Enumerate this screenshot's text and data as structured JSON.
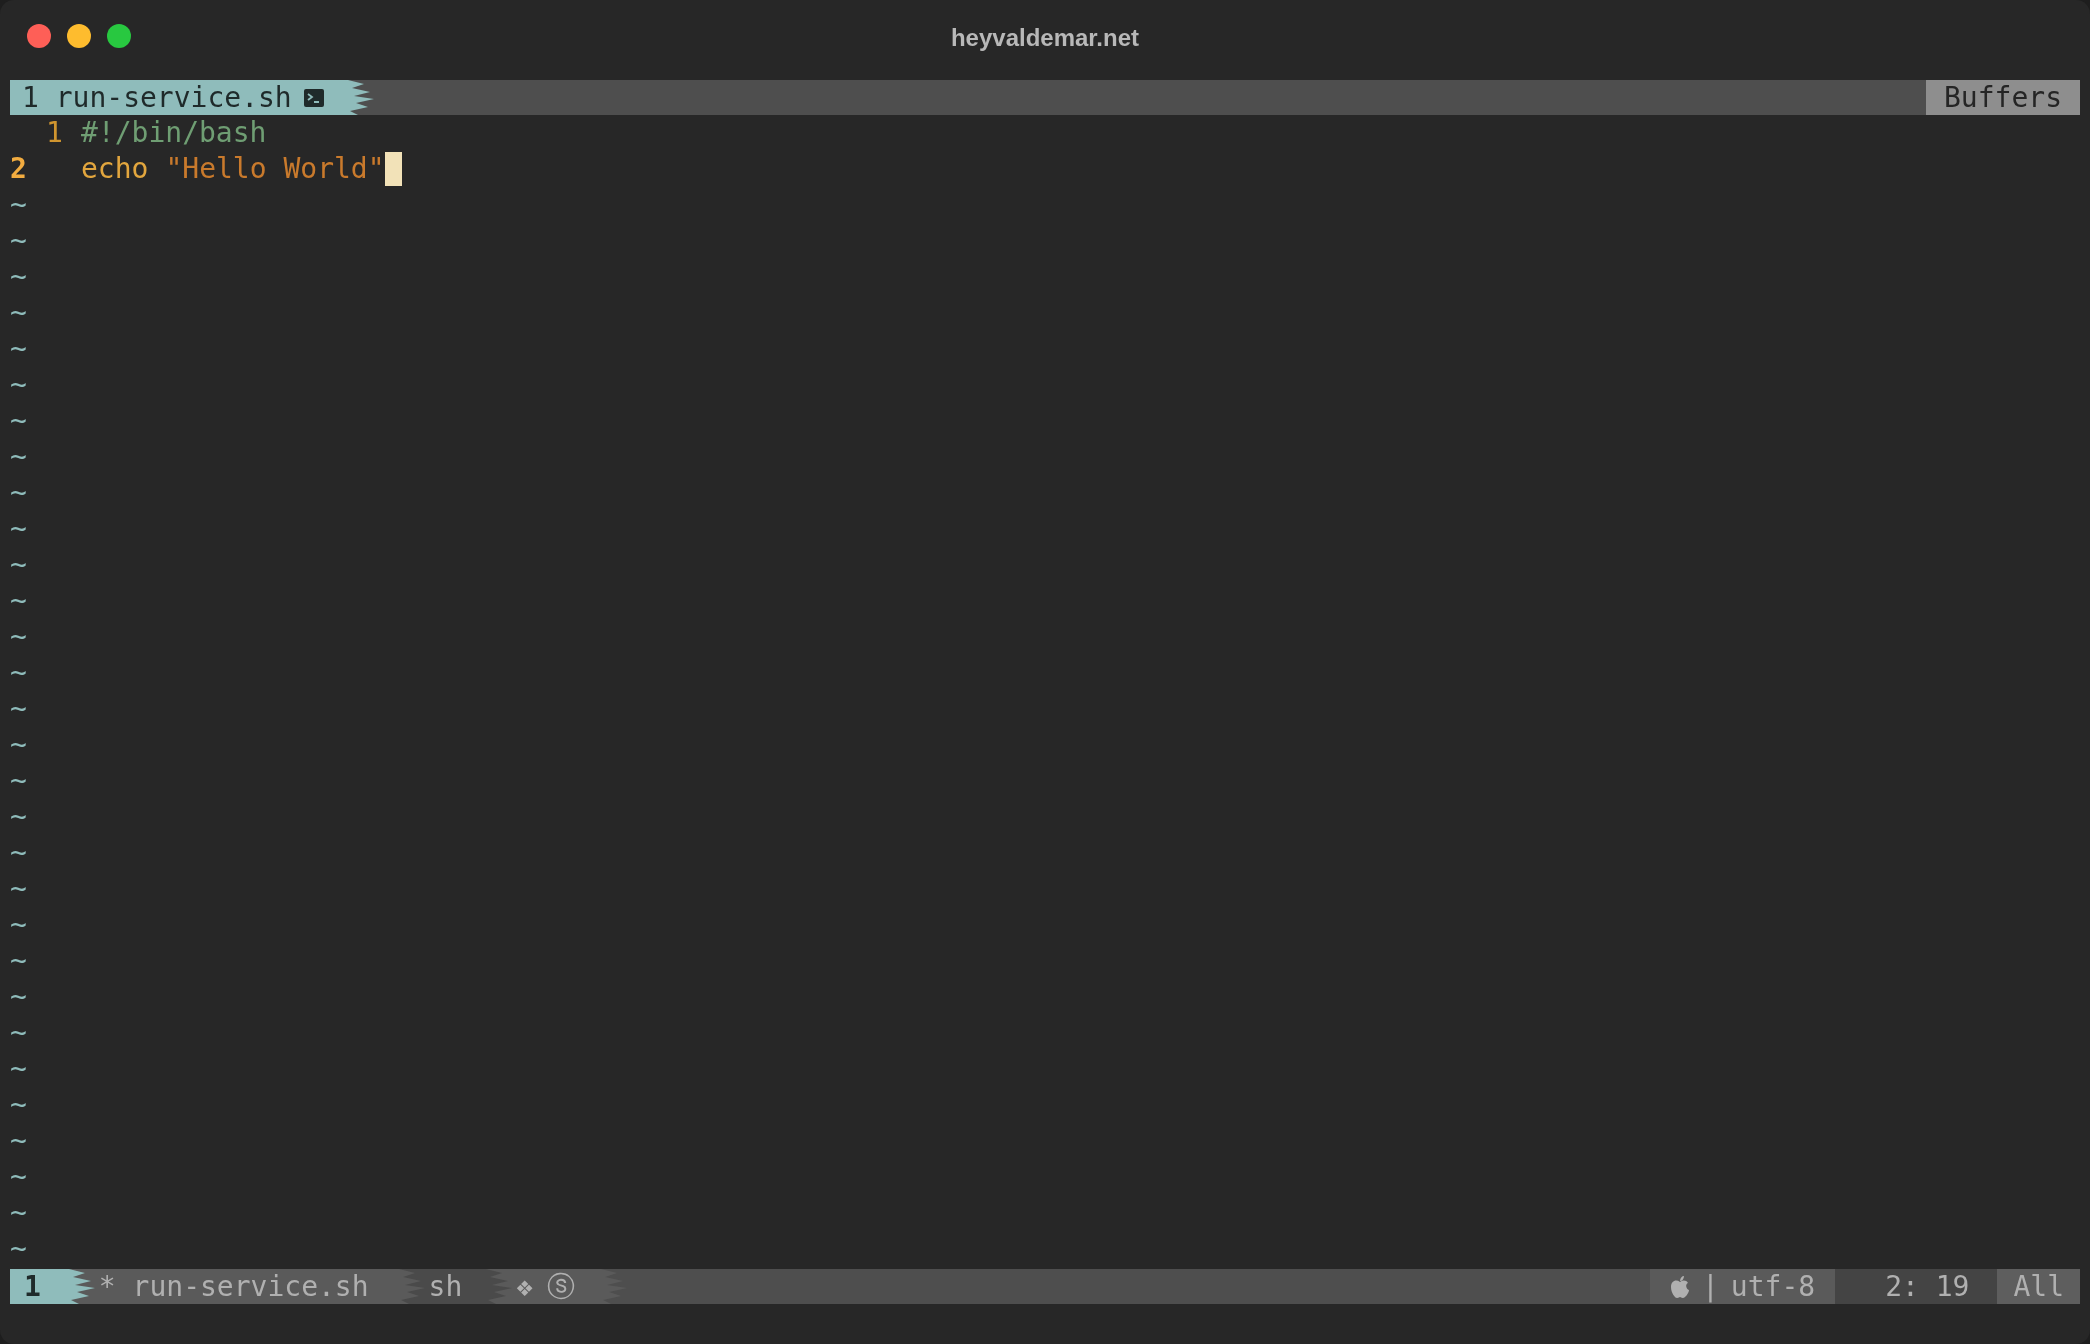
{
  "window": {
    "title": "heyvaldemar.net"
  },
  "tabline": {
    "tabs": [
      {
        "number": "1",
        "name": "run-service.sh",
        "selected": true
      }
    ],
    "right_label": "Buffers"
  },
  "lines": [
    {
      "number": "1",
      "current": false,
      "cursor": false,
      "tokens": [
        {
          "kind": "comment",
          "text": "#!/bin/bash"
        }
      ]
    },
    {
      "number": "2",
      "current": true,
      "cursor": true,
      "tokens": [
        {
          "kind": "builtin",
          "text": "echo"
        },
        {
          "kind": "string",
          "text": "\"Hello World\""
        }
      ]
    }
  ],
  "empty_lines": [
    "~",
    "~",
    "~",
    "~",
    "~",
    "~",
    "~",
    "~",
    "~",
    "~",
    "~",
    "~",
    "~",
    "~",
    "~",
    "~",
    "~",
    "~",
    "~",
    "~",
    "~",
    "~",
    "~",
    "~",
    "~",
    "~",
    "~",
    "~",
    "~",
    "~"
  ],
  "status_bar": {
    "mode": "1",
    "file": "* run-service.sh",
    "filetype": "sh",
    "symbols": [
      "❖",
      "ⓢ"
    ],
    "separator": "|",
    "encoding": "utf-8",
    "position": "2: 19",
    "scroll": "All"
  }
}
